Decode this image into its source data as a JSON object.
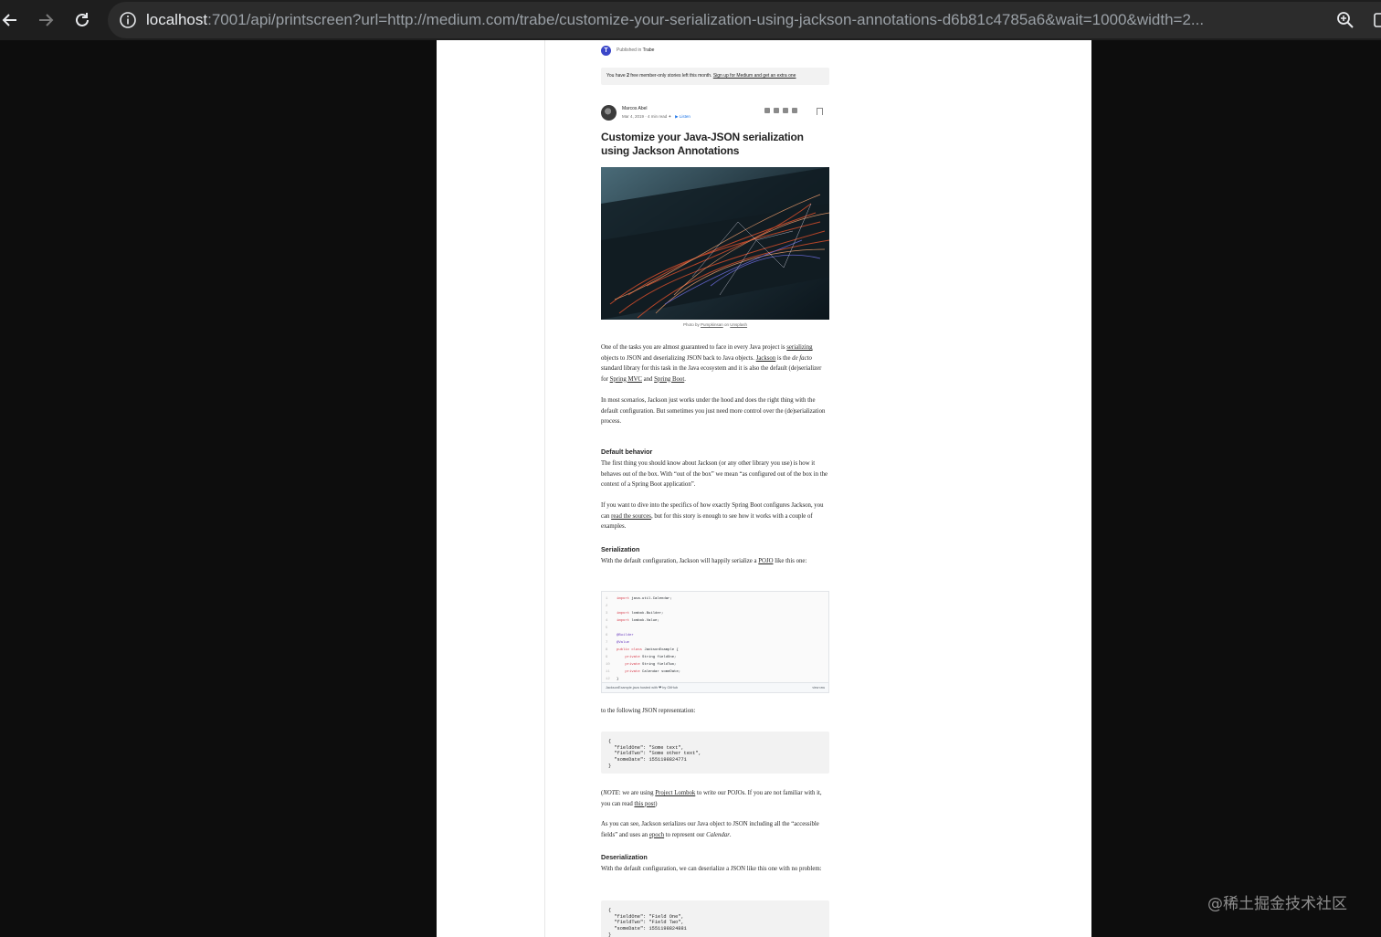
{
  "browser": {
    "url_host": "localhost",
    "url_rest": ":7001/api/printscreen?url=http://medium.com/trabe/customize-your-serialization-using-jackson-annotations-d6b81c4785a6&wait=1000&width=2..."
  },
  "article": {
    "publication_prefix": "Published in",
    "publication_name": "Trabe",
    "publication_logo_letter": "T",
    "member_banner_a": "You have ",
    "member_banner_b": "2",
    "member_banner_c": " free member-only stories left this month. ",
    "member_banner_link": "Sign up for Medium and get an extra one",
    "author_name": "Marcos Abel",
    "author_date": "Mar 4, 2019",
    "author_read": "4 min read",
    "listen": "Listen",
    "title": "Customize your Java-JSON serialization using Jackson Annotations",
    "caption_prefix": "Photo by ",
    "caption_author": "Pumpkinsan",
    "caption_mid": " on ",
    "caption_site": "Unsplash",
    "p1_a": "One of the tasks you are almost guaranteed to face in every Java project is ",
    "p1_link1": "serializing",
    "p1_b": " objects to JSON and deserializing JSON back to Java objects. ",
    "p1_link2": "Jackson",
    "p1_c": " is the ",
    "p1_em": "de facto",
    "p1_d": " standard library for this task in the Java ecosystem and it is also the default (de)serializer for ",
    "p1_link3": "Spring MVC",
    "p1_e": " and ",
    "p1_link4": "Spring Boot",
    "p1_f": ".",
    "p2": "In most scenarios, Jackson just works under the hood and does the right thing with the default configuration. But sometimes you just need more control over the (de)serialization process.",
    "h_default": "Default behavior",
    "p3": "The first thing you should know about Jackson (or any other library you use) is how it behaves out of the box. With “out of the box” we mean “as configured out of the box in the context of a Spring Boot application”.",
    "p4_a": "If you want to dive into the specifics of how exactly Spring Boot configures Jackson, you can ",
    "p4_link": "read the sources",
    "p4_b": ", but for this story is enough to see how it works with a couple of examples.",
    "h_serialization": "Serialization",
    "p5_a": "With the default configuration, Jackson will happily serialize a ",
    "p5_link": "POJO",
    "p5_b": " like this one:",
    "gist_footer": "JacksonExample.java hosted with ❤ by GitHub",
    "gist_raw": "view raw",
    "p6": "to the following JSON representation:",
    "json1": "{\n  \"fieldOne\": \"Some text\",\n  \"fieldTwo\": \"Some other text\",\n  \"someDate\": 1551198824771\n}",
    "p7_a": "(",
    "p7_em": "NOTE",
    "p7_b": ": we are using ",
    "p7_link1": "Project Lombok",
    "p7_c": " to write our POJOs. If you are not familiar with it, you can read ",
    "p7_link2": "this post",
    "p7_d": ")",
    "p8_a": "As you can see, Jackson serializes our Java object to JSON including all the “accessible fields” and uses an ",
    "p8_link": "epoch",
    "p8_b": " to represent our ",
    "p8_em": "Calendar",
    "p8_c": ".",
    "h_deserialization": "Deserialization",
    "p9": "With the default configuration, we can deserialize a JSON like this one with no problem:",
    "json2": "{\n  \"fieldOne\": \"Field One\",\n  \"fieldTwo\": \"Field Two\",\n  \"someDate\": 1551198824881\n}"
  },
  "gist_lines": [
    {
      "n": "1",
      "kw": "import",
      "rest": " java.util.Calendar;"
    },
    {
      "n": "2",
      "kw": "",
      "rest": ""
    },
    {
      "n": "3",
      "kw": "import",
      "rest": " lombok.Builder;"
    },
    {
      "n": "4",
      "kw": "import",
      "rest": " lombok.Value;"
    },
    {
      "n": "5",
      "kw": "",
      "rest": ""
    },
    {
      "n": "6",
      "an": "@Builder",
      "rest": ""
    },
    {
      "n": "7",
      "an": "@Value",
      "rest": ""
    },
    {
      "n": "8",
      "kw": "public class",
      "rest": " JacksonExample {"
    },
    {
      "n": "9",
      "kw": "    private",
      "rest": " String fieldOne;"
    },
    {
      "n": "10",
      "kw": "    private",
      "rest": " String fieldTwo;"
    },
    {
      "n": "11",
      "kw": "    private",
      "rest": " Calendar someDate;"
    },
    {
      "n": "12",
      "kw": "",
      "rest": "}"
    }
  ],
  "watermark": "@稀土掘金技术社区"
}
